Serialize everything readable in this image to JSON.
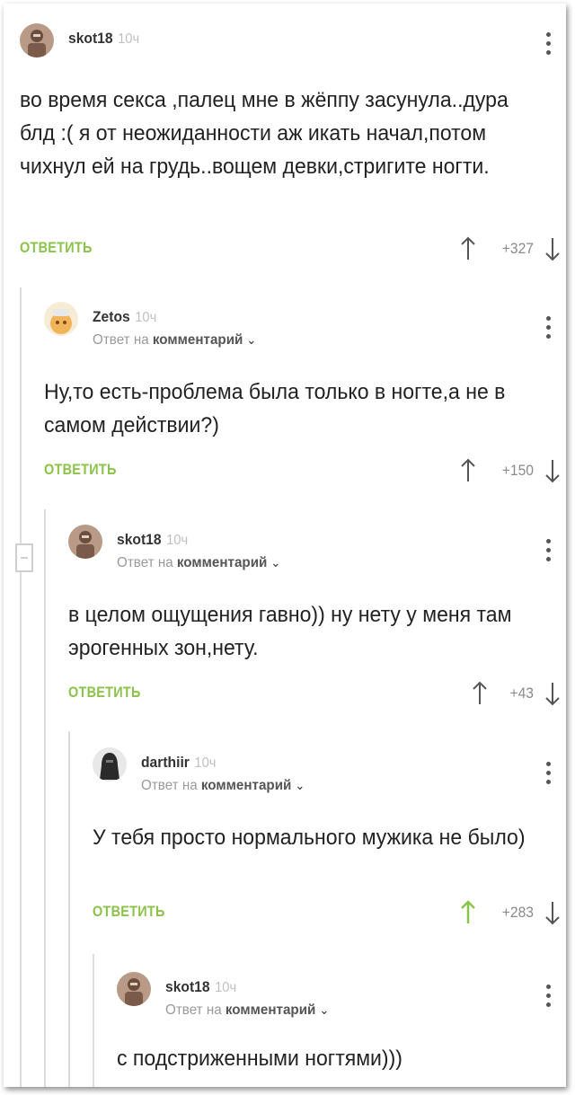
{
  "colors": {
    "accent": "#8bc34a",
    "muted": "#9a9a9a",
    "time": "#c0c0c0",
    "text": "#222222",
    "branch": "#dcdcdc"
  },
  "comments": [
    {
      "user": "skot18",
      "time": "10ч",
      "reply_prefix": "",
      "reply_target": "",
      "text": "во время секса ,палец мне в жёппу засунула..дура блд :( я от неожиданности аж икать начал,потом чихнул ей на грудь..вощем девки,стригите ногти.",
      "answer_label": "ОТВЕТИТЬ",
      "score": "+327",
      "upvoted": false,
      "avatar_icon": "user-photo-icon"
    },
    {
      "user": "Zetos",
      "time": "10ч",
      "reply_prefix": "Ответ на",
      "reply_target": "комментарий",
      "text": "Ну,то есть-проблема была только в ногте,а не в самом действии?)",
      "answer_label": "ОТВЕТИТЬ",
      "score": "+150",
      "upvoted": false,
      "avatar_icon": "cartoon-avatar-icon"
    },
    {
      "user": "skot18",
      "time": "10ч",
      "reply_prefix": "Ответ на",
      "reply_target": "комментарий",
      "text": "в целом ощущения гавно)) ну нету у меня там эрогенных зон,нету.",
      "answer_label": "ОТВЕТИТЬ",
      "score": "+43",
      "upvoted": false,
      "avatar_icon": "user-photo-icon"
    },
    {
      "user": "darthiir",
      "time": "10ч",
      "reply_prefix": "Ответ на",
      "reply_target": "комментарий",
      "text": "У тебя просто нормального мужика не было)",
      "answer_label": "ОТВЕТИТЬ",
      "score": "+283",
      "upvoted": true,
      "avatar_icon": "dark-figure-avatar-icon"
    },
    {
      "user": "skot18",
      "time": "10ч",
      "reply_prefix": "Ответ на",
      "reply_target": "комментарий",
      "text": "с подстриженными ногтями)))",
      "answer_label": "",
      "score": "",
      "upvoted": false,
      "avatar_icon": "user-photo-icon"
    }
  ]
}
